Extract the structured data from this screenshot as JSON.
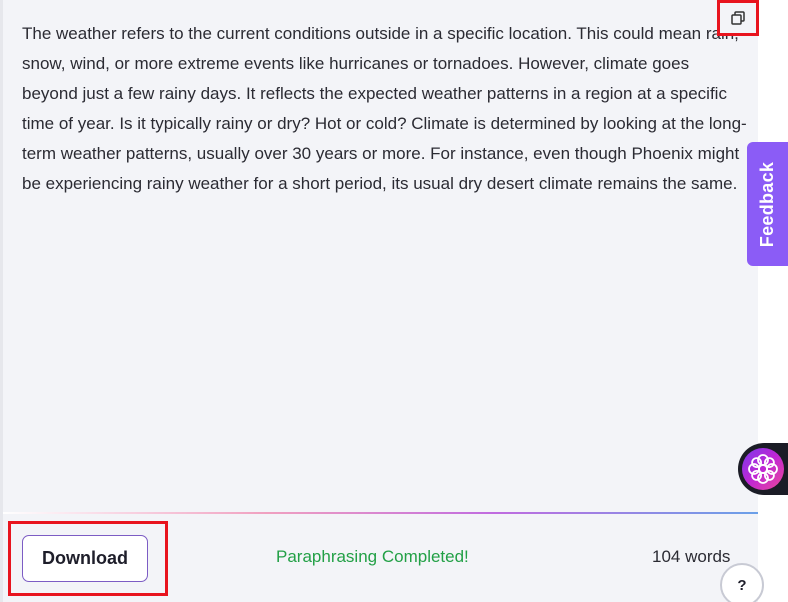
{
  "content": {
    "paragraph": "The weather refers to the current conditions outside in a specific location. This could mean rain, snow, wind, or more extreme events like hurricanes or tornadoes. However, climate goes beyond just a few rainy days. It reflects the expected weather patterns in a region at a specific time of year. Is it typically rainy or dry? Hot or cold? Climate is determined by looking at the long-term weather patterns, usually over 30 years or more. For instance, even though Phoenix might be experiencing rainy weather for a short period, its usual dry desert climate remains the same."
  },
  "toolbar": {
    "copy_icon": "copy-icon"
  },
  "side": {
    "feedback_label": "Feedback",
    "assistant_icon": "flower-logo-icon"
  },
  "footer": {
    "download_label": "Download",
    "status_text": "Paraphrasing Completed!",
    "word_count": "104 words",
    "help_label": "?"
  },
  "colors": {
    "highlight_box": "#e8141e",
    "feedback_tab": "#8b5cf6",
    "status_green": "#22a046",
    "button_border": "#7c5cc4"
  }
}
